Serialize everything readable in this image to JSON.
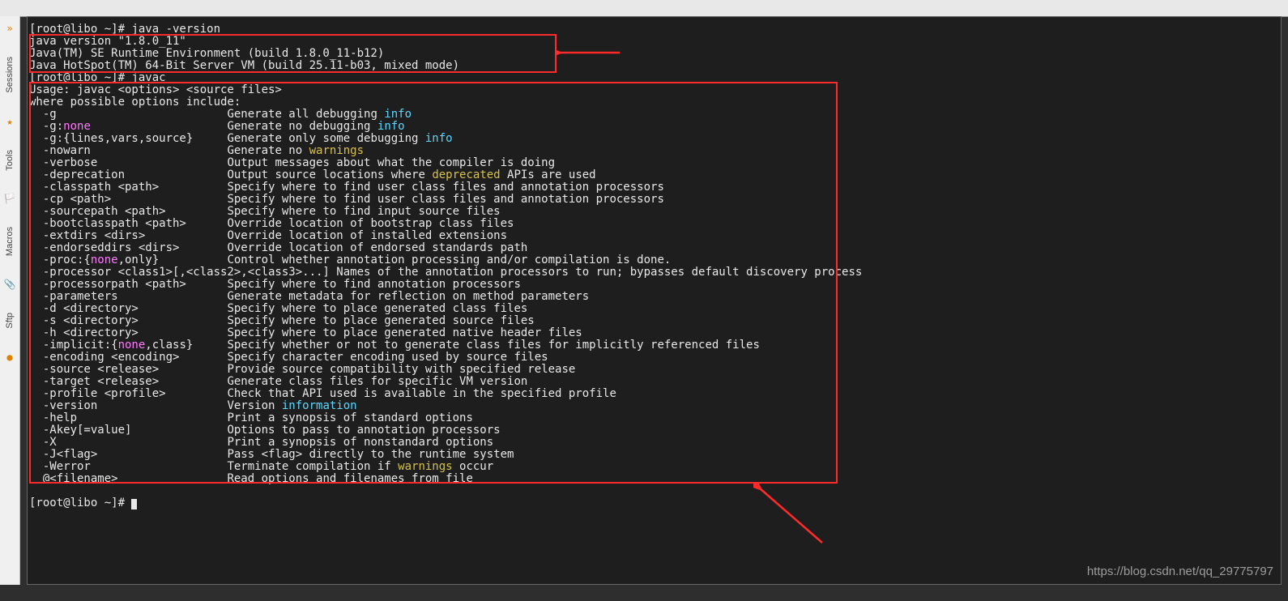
{
  "sidebar": {
    "tabs": [
      "Sessions",
      "Tools",
      "Macros",
      "Sftp"
    ]
  },
  "terminal": {
    "prompt1": "[root@libo ~]# java -version",
    "ver": [
      {
        "t": "java version \"1.8.0_11\""
      },
      {
        "t": "Java(TM) SE Runtime Environment (build 1.8.0_11-b12)"
      },
      {
        "t": "Java HotSpot(TM) 64-Bit Server VM (build 25.11-b03, mixed mode)"
      }
    ],
    "prompt2": "[root@libo ~]# javac",
    "usage": "Usage: javac <options> <source files>",
    "where": "where possible options include:",
    "opts": [
      {
        "o": "  -g                         ",
        "d": "Generate all debugging ",
        "c": "info",
        "e": ""
      },
      {
        "o": "  -g:",
        "m": "none",
        "d": "                    Generate no debugging ",
        "c": "info",
        "e": ""
      },
      {
        "o": "  -g:{lines,vars,source}     ",
        "d": "Generate only some debugging ",
        "c": "info",
        "e": ""
      },
      {
        "o": "  -nowarn                    ",
        "d": "Generate no ",
        "y": "warnings",
        "e": ""
      },
      {
        "o": "  -verbose                   ",
        "d": "Output messages about what the compiler is doing"
      },
      {
        "o": "  -deprecation               ",
        "d": "Output source locations where ",
        "y": "deprecated",
        "e": " APIs are used"
      },
      {
        "o": "  -classpath <path>          ",
        "d": "Specify where to find user class files and annotation processors"
      },
      {
        "o": "  -cp <path>                 ",
        "d": "Specify where to find user class files and annotation processors"
      },
      {
        "o": "  -sourcepath <path>         ",
        "d": "Specify where to find input source files"
      },
      {
        "o": "  -bootclasspath <path>      ",
        "d": "Override location of bootstrap class files"
      },
      {
        "o": "  -extdirs <dirs>            ",
        "d": "Override location of installed extensions"
      },
      {
        "o": "  -endorseddirs <dirs>       ",
        "d": "Override location of endorsed standards path"
      },
      {
        "o": "  -proc:{",
        "m": "none",
        "d": ",only}          Control whether annotation processing and/or compilation is done."
      },
      {
        "o": "  -processor <class1>[,<class2>,<class3>...] ",
        "d": "Names of the annotation processors to run; bypasses default discovery process"
      },
      {
        "o": "  -processorpath <path>      ",
        "d": "Specify where to find annotation processors"
      },
      {
        "o": "  -parameters                ",
        "d": "Generate metadata for reflection on method parameters"
      },
      {
        "o": "  -d <directory>             ",
        "d": "Specify where to place generated class files"
      },
      {
        "o": "  -s <directory>             ",
        "d": "Specify where to place generated source files"
      },
      {
        "o": "  -h <directory>             ",
        "d": "Specify where to place generated native header files"
      },
      {
        "o": "  -implicit:{",
        "m": "none",
        "d": ",class}     Specify whether or not to generate class files for implicitly referenced files"
      },
      {
        "o": "  -encoding <encoding>       ",
        "d": "Specify character encoding used by source files"
      },
      {
        "o": "  -source <release>          ",
        "d": "Provide source compatibility with specified release"
      },
      {
        "o": "  -target <release>          ",
        "d": "Generate class files for specific VM version"
      },
      {
        "o": "  -profile <profile>         ",
        "d": "Check that API used is available in the specified profile"
      },
      {
        "o": "  -version                   ",
        "d": "Version ",
        "c": "information",
        "e": ""
      },
      {
        "o": "  -help                      ",
        "d": "Print a synopsis of standard options"
      },
      {
        "o": "  -Akey[=value]              ",
        "d": "Options to pass to annotation processors"
      },
      {
        "o": "  -X                         ",
        "d": "Print a synopsis of nonstandard options"
      },
      {
        "o": "  -J<flag>                   ",
        "d": "Pass <flag> directly to the runtime system"
      },
      {
        "o": "  -Werror                    ",
        "d": "Terminate compilation if ",
        "y": "warnings",
        "e": " occur"
      },
      {
        "o": "  @<filename>                ",
        "d": "Read options and filenames from file"
      }
    ],
    "prompt3": "[root@libo ~]# "
  },
  "watermark": "https://blog.csdn.net/qq_29775797"
}
